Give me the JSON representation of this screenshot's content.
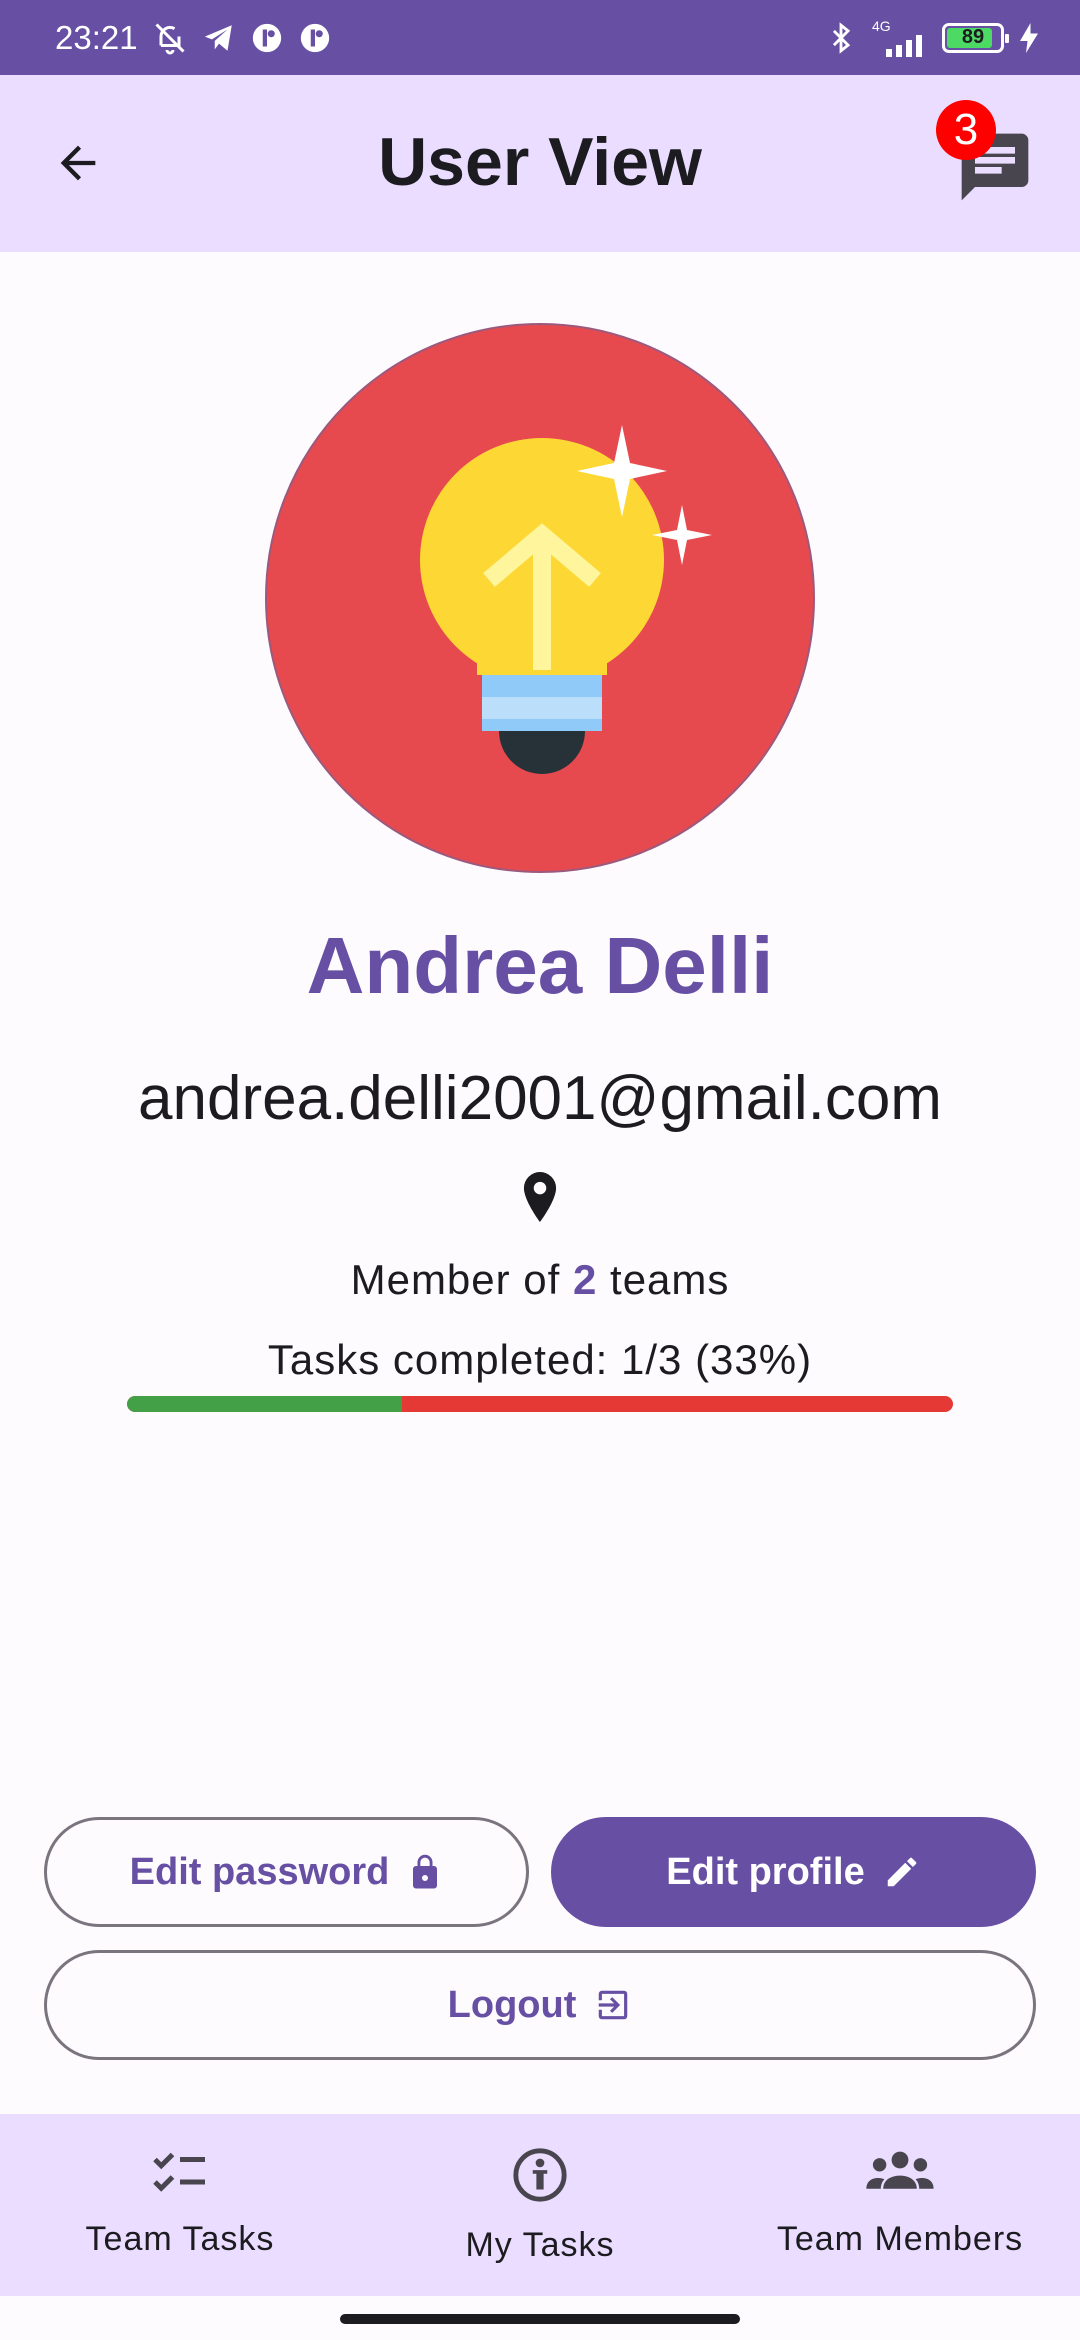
{
  "status_bar": {
    "time": "23:21",
    "network": "4G",
    "battery": "89"
  },
  "app_bar": {
    "title": "User View",
    "chat_badge": "3"
  },
  "profile": {
    "name": "Andrea Delli",
    "email": "andrea.delli2001@gmail.com",
    "members_prefix": "Member of ",
    "members_count": "2",
    "members_suffix": " teams",
    "tasks_text": "Tasks completed: 1/3 (33%)",
    "tasks_progress_fraction": 0.333,
    "progress_colors": {
      "done": "#43a047",
      "remaining": "#e53935"
    }
  },
  "actions": {
    "edit_password": "Edit password",
    "edit_profile": "Edit profile",
    "logout": "Logout"
  },
  "bottom_nav": {
    "items": [
      {
        "label": "Team Tasks",
        "icon": "checklist-icon"
      },
      {
        "label": "My Tasks",
        "icon": "person-info-icon"
      },
      {
        "label": "Team Members",
        "icon": "group-icon"
      }
    ]
  },
  "colors": {
    "primary": "#6750a4",
    "appbar_bg": "#eaddff",
    "avatar_bg": "#e64a4f"
  }
}
